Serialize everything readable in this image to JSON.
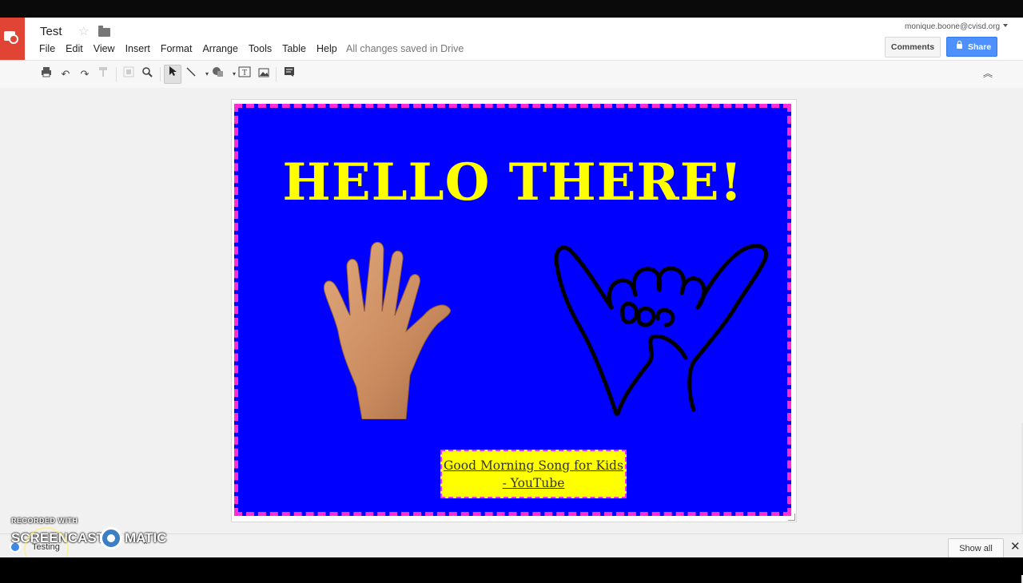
{
  "document": {
    "title": "Test",
    "save_status": "All changes saved in Drive"
  },
  "menu": [
    "File",
    "Edit",
    "View",
    "Insert",
    "Format",
    "Arrange",
    "Tools",
    "Table",
    "Help"
  ],
  "user": {
    "email": "monique.boone@cvisd.org"
  },
  "buttons": {
    "comments": "Comments",
    "share": "Share",
    "show_all": "Show all"
  },
  "toolbar_icons": [
    "print-icon",
    "undo-icon",
    "redo-icon",
    "paint-format-icon",
    "zoom-fit-icon",
    "zoom-icon",
    "select-icon",
    "line-icon",
    "shape-icon",
    "textbox-icon",
    "image-icon",
    "comment-icon",
    "collapse-icon"
  ],
  "slide": {
    "heading": "HELLO THERE!",
    "link_text": "Good Morning Song for Kids - YouTube",
    "background_color": "#0000ff",
    "border_color": "#ff2bd6",
    "text_color": "#ffff00"
  },
  "download_bar": {
    "file_name": "Testing"
  },
  "watermark": {
    "line1": "RECORDED WITH",
    "line2a": "SCREENCAST",
    "line2b": "MATIC"
  }
}
